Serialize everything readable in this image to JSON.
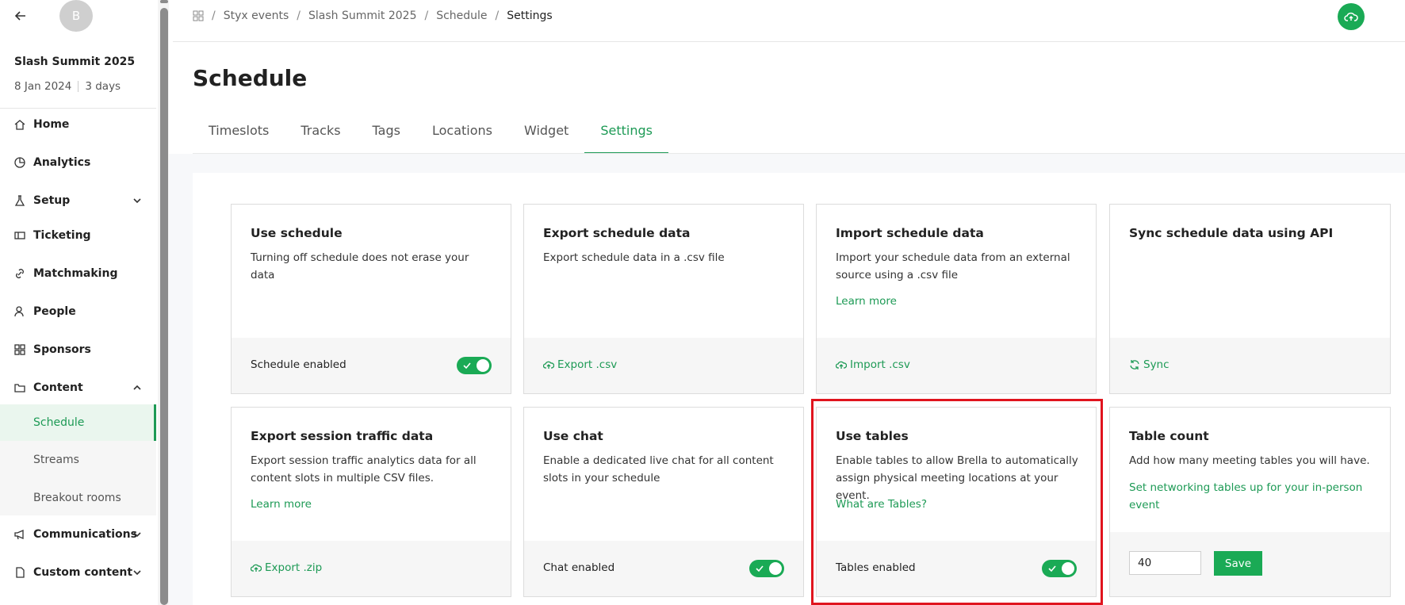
{
  "sidebar": {
    "avatar_initial": "B",
    "event_name": "Slash Summit 2025",
    "event_date": "8 Jan 2024",
    "event_duration": "3 days",
    "items": [
      {
        "label": "Home",
        "icon": "home-icon"
      },
      {
        "label": "Analytics",
        "icon": "pie-chart-icon"
      },
      {
        "label": "Setup",
        "icon": "flask-icon"
      },
      {
        "label": "Ticketing",
        "icon": "ticket-icon"
      },
      {
        "label": "Matchmaking",
        "icon": "link-icon"
      },
      {
        "label": "People",
        "icon": "people-icon"
      },
      {
        "label": "Sponsors",
        "icon": "grid-icon"
      },
      {
        "label": "Content",
        "icon": "folder-icon"
      },
      {
        "label": "Communications",
        "icon": "megaphone-icon"
      },
      {
        "label": "Custom content",
        "icon": "file-icon"
      }
    ],
    "sub_items": [
      "Schedule",
      "Streams",
      "Breakout rooms"
    ]
  },
  "breadcrumb": [
    "Styx events",
    "Slash Summit 2025",
    "Schedule",
    "Settings"
  ],
  "page_title": "Schedule",
  "tabs": [
    "Timeslots",
    "Tracks",
    "Tags",
    "Locations",
    "Widget",
    "Settings"
  ],
  "cards": {
    "use_schedule": {
      "title": "Use schedule",
      "desc": "Turning off schedule does not erase your data",
      "footer": "Schedule enabled"
    },
    "export_schedule": {
      "title": "Export schedule data",
      "desc": "Export schedule data in a .csv file",
      "action": "Export .csv"
    },
    "import_schedule": {
      "title": "Import schedule data",
      "desc": "Import your schedule data from an external source using a .csv file",
      "link": "Learn more",
      "action": "Import .csv"
    },
    "sync_schedule": {
      "title": "Sync schedule data using API",
      "action": "Sync"
    },
    "export_traffic": {
      "title": "Export session traffic data",
      "desc": "Export session traffic analytics data for all content slots in multiple CSV files.",
      "link": "Learn more",
      "action": "Export .zip"
    },
    "use_chat": {
      "title": "Use chat",
      "desc": "Enable a dedicated live chat for all content slots in your schedule",
      "footer": "Chat enabled"
    },
    "use_tables": {
      "title": "Use tables",
      "desc": "Enable tables to allow Brella to automatically assign physical meeting locations at your event.",
      "link": "What are Tables?",
      "footer": "Tables enabled"
    },
    "table_count": {
      "title": "Table count",
      "desc": "Add how many meeting tables you will have.",
      "link": "Set networking tables up for your in-person event",
      "value": "40",
      "save": "Save"
    }
  },
  "colors": {
    "accent": "#1d9a55",
    "highlight": "#e0141e"
  }
}
